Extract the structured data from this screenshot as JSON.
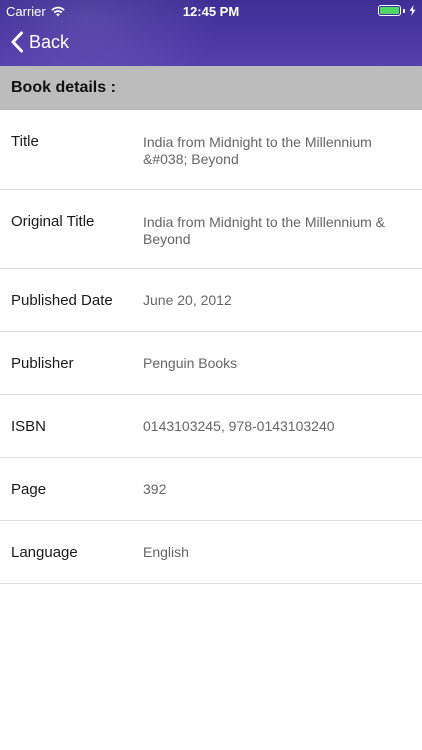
{
  "status_bar": {
    "carrier": "Carrier",
    "time": "12:45 PM",
    "battery_level": 1.0,
    "battery_color": "#4cd964"
  },
  "nav": {
    "back_label": "Back",
    "back_icon": "chevron-left-icon"
  },
  "colors": {
    "nav_background": "#4a37a3",
    "section_header_background": "#bcbcbc"
  },
  "section": {
    "title": "Book details :"
  },
  "details": [
    {
      "label": "Title",
      "value": "India from Midnight to the Millennium &#038; Beyond"
    },
    {
      "label": "Original Title",
      "value": "India from Midnight to the Millennium & Beyond"
    },
    {
      "label": "Published Date",
      "value": "June 20, 2012"
    },
    {
      "label": "Publisher",
      "value": "Penguin Books"
    },
    {
      "label": "ISBN",
      "value": "0143103245, 978-0143103240"
    },
    {
      "label": "Page",
      "value": "392"
    },
    {
      "label": "Language",
      "value": "English"
    }
  ]
}
